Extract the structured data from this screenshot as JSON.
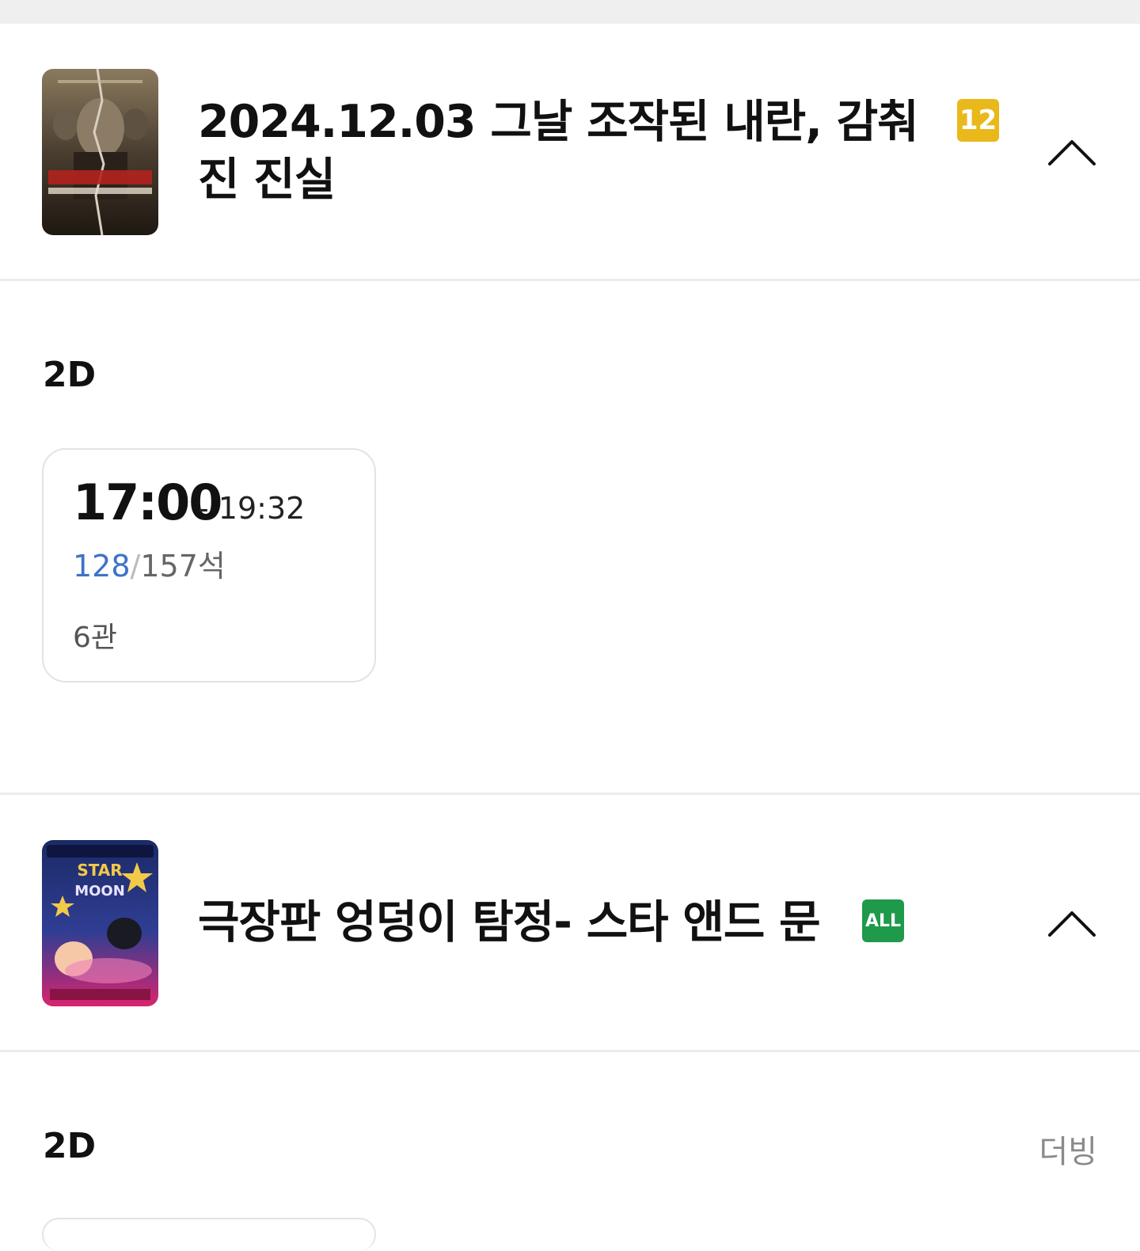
{
  "movies": [
    {
      "title": "2024.12.03 그날 조작된 내란, 감춰진 진실",
      "rating": "12",
      "rating_color": "#e9b81a",
      "format": "2D",
      "dub": "",
      "showtimes": [
        {
          "start": "17:00",
          "end": "- 19:32",
          "available": "128",
          "separator": "/",
          "total": "157석",
          "hall": "6관"
        }
      ]
    },
    {
      "title": "극장판 엉덩이 탐정- 스타 앤드 문",
      "rating": "ALL",
      "rating_color": "#1f9a4a",
      "format": "2D",
      "dub": "더빙",
      "showtimes": []
    }
  ],
  "icons": {
    "collapse": "chevron-up-icon"
  },
  "colors": {
    "available_seats": "#3d73c7",
    "divider": "#ececec"
  }
}
